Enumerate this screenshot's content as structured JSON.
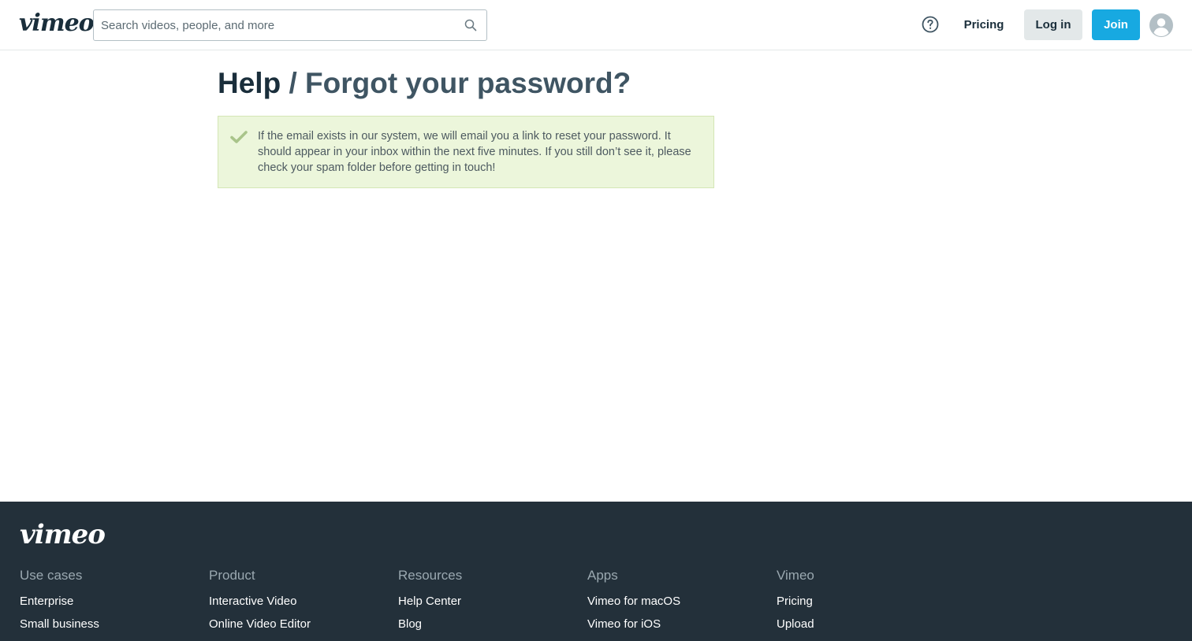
{
  "header": {
    "logo": "vimeo",
    "search": {
      "placeholder": "Search videos, people, and more",
      "value": ""
    },
    "pricing_label": "Pricing",
    "login_label": "Log in",
    "join_label": "Join"
  },
  "main": {
    "breadcrumb": {
      "parent": "Help",
      "separator": "/",
      "current": "Forgot your password?"
    },
    "notice": {
      "text": "If the email exists in our system, we will email you a link to reset your password. It should appear in your inbox within the next five minutes. If you still don’t see it, please check your spam folder before getting in touch!"
    }
  },
  "footer": {
    "logo": "vimeo",
    "columns": [
      {
        "heading": "Use cases",
        "links": [
          "Enterprise",
          "Small business"
        ]
      },
      {
        "heading": "Product",
        "links": [
          "Interactive Video",
          "Online Video Editor"
        ]
      },
      {
        "heading": "Resources",
        "links": [
          "Help Center",
          "Blog"
        ]
      },
      {
        "heading": "Apps",
        "links": [
          "Vimeo for macOS",
          "Vimeo for iOS"
        ]
      },
      {
        "heading": "Vimeo",
        "links": [
          "Pricing",
          "Upload"
        ]
      }
    ]
  },
  "colors": {
    "brand_blue": "#17a9e1",
    "text_dark": "#1a2e3b",
    "notice_bg": "#ecf6db",
    "check_green": "#a9c48a",
    "footer_bg": "#23303a"
  },
  "icons": {
    "search": "search-icon",
    "help": "help-circle-icon",
    "avatar": "user-avatar-icon",
    "success": "check-icon"
  }
}
